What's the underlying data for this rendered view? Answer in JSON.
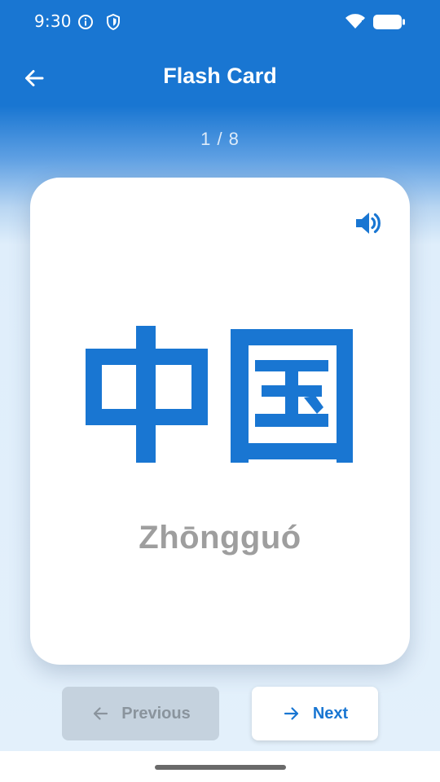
{
  "status_bar": {
    "time": "9:30",
    "icons": [
      "info-icon",
      "shield-icon",
      "wifi-icon",
      "battery-icon"
    ]
  },
  "app_bar": {
    "title": "Flash Card",
    "back_icon": "arrow-left-icon"
  },
  "progress": {
    "label": "1 / 8",
    "current": 1,
    "total": 8
  },
  "card": {
    "characters": "中国",
    "pinyin": "Zhōngguó",
    "speaker_icon": "volume-up-icon"
  },
  "navigation": {
    "previous_label": "Previous",
    "previous_enabled": false,
    "next_label": "Next",
    "next_enabled": true
  },
  "colors": {
    "primary": "#1976d2",
    "pinyin_text": "#9e9e9e",
    "disabled_button": "#c5d2de",
    "background_light": "#e3f0fb"
  }
}
